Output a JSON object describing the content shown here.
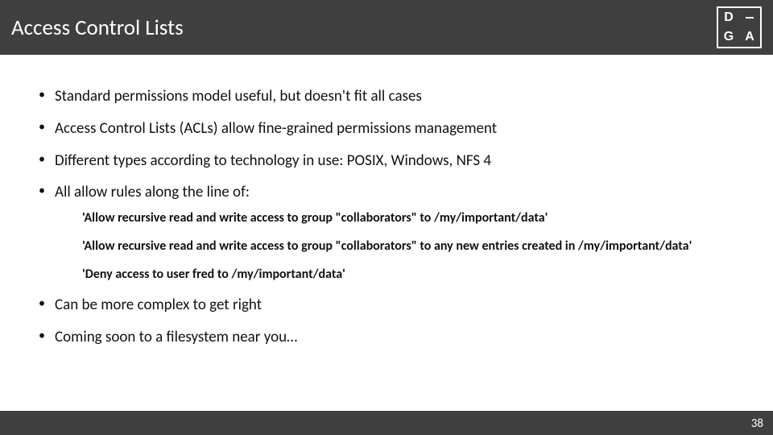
{
  "title": "Access Control Lists",
  "logo": {
    "tl": "D",
    "bl": "G",
    "br": "A"
  },
  "bullets": [
    "Standard permissions model useful, but doesn't fit all cases",
    "Access Control Lists (ACLs) allow fine-grained permissions management",
    "Different types according to technology in use: POSIX, Windows, NFS 4",
    "All allow rules along the line of:",
    "Can be more complex to get right",
    "Coming soon to a filesystem near you…"
  ],
  "sub_bullets": [
    "'Allow recursive read and write access to group  \"collaborators\" to /my/important/data'",
    "'Allow recursive read and write access to group  \"collaborators\" to any new entries created in /my/important/data'",
    "'Deny access to user fred to /my/important/data'"
  ],
  "page_number": "38"
}
